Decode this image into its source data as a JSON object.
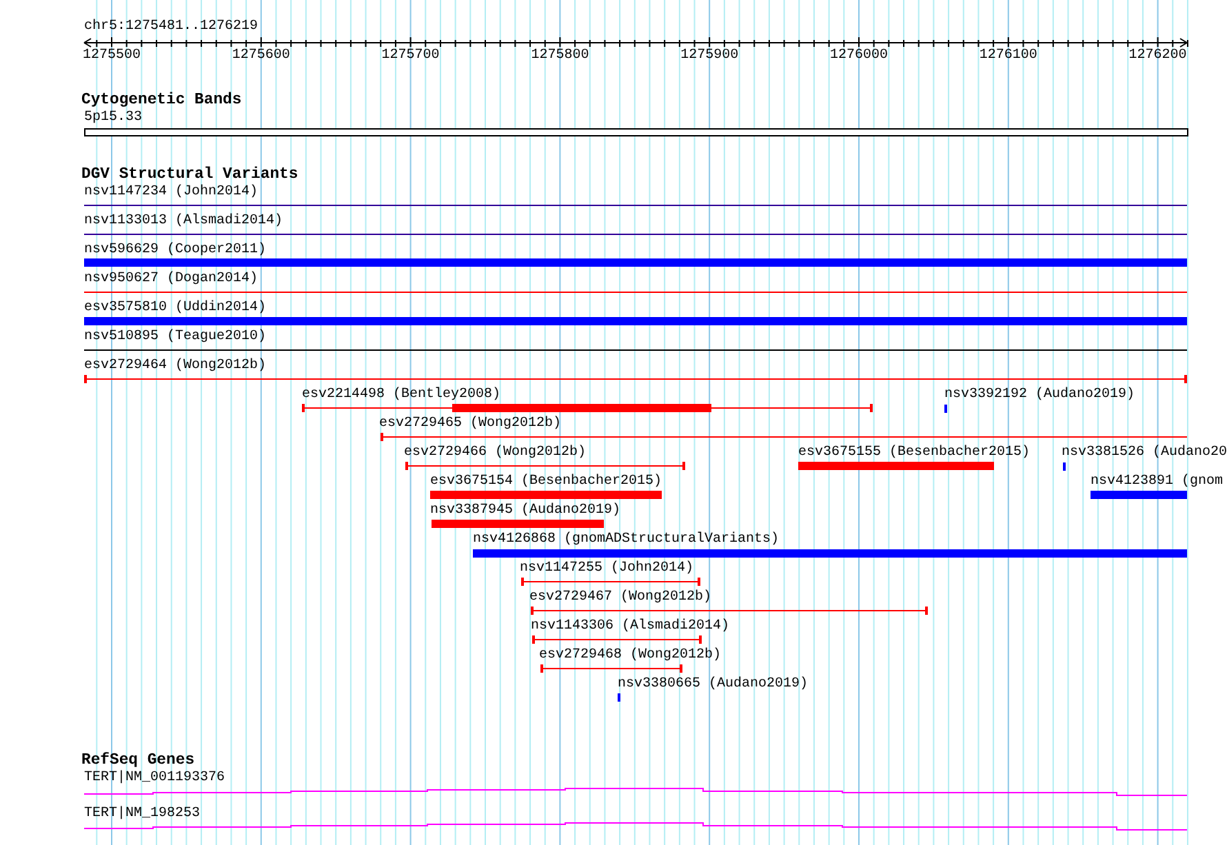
{
  "ruler": {
    "region": "chr5:1275481..1276219",
    "tick_labels": [
      "1275500",
      "1275600",
      "1275700",
      "1275800",
      "1275900",
      "1276000",
      "1276100",
      "1276200"
    ]
  },
  "cytogenetic_bands": {
    "title": "Cytogenetic Bands",
    "bands": [
      {
        "label": "5p15.33"
      }
    ]
  },
  "dgv_structural_variants": {
    "title": "DGV Structural Variants",
    "features": [
      {
        "label": "nsv1147234 (John2014)",
        "kind": "line",
        "color": "#330099"
      },
      {
        "label": "nsv1133013 (Alsmadi2014)",
        "kind": "line",
        "color": "#330099"
      },
      {
        "label": "nsv596629 (Cooper2011)",
        "kind": "bar",
        "color": "#0000ff"
      },
      {
        "label": "nsv950627 (Dogan2014)",
        "kind": "line",
        "color": "#ff0000"
      },
      {
        "label": "esv3575810 (Uddin2014)",
        "kind": "bar",
        "color": "#0000ff"
      },
      {
        "label": "nsv510895 (Teague2010)",
        "kind": "line",
        "color": "#000000"
      },
      {
        "label": "esv2729464 (Wong2012b)",
        "kind": "span",
        "color": "#ff0000"
      },
      {
        "label": "esv2214498 (Bentley2008)",
        "kind": "span-bar",
        "color": "#ff0000"
      },
      {
        "label": "nsv3392192 (Audano2019)",
        "kind": "tick",
        "color": "#0000ff"
      },
      {
        "label": "esv2729465 (Wong2012b)",
        "kind": "span",
        "color": "#ff0000"
      },
      {
        "label": "esv2729466 (Wong2012b)",
        "kind": "span",
        "color": "#ff0000"
      },
      {
        "label": "esv3675155 (Besenbacher2015)",
        "kind": "bar",
        "color": "#ff0000"
      },
      {
        "label": "nsv3381526 (Audano20",
        "kind": "tick",
        "color": "#0000ff"
      },
      {
        "label": "esv3675154 (Besenbacher2015)",
        "kind": "bar",
        "color": "#ff0000"
      },
      {
        "label": "nsv4123891 (gnom",
        "kind": "bar",
        "color": "#0000ff"
      },
      {
        "label": "nsv3387945 (Audano2019)",
        "kind": "bar",
        "color": "#ff0000"
      },
      {
        "label": "nsv4126868 (gnomADStructuralVariants)",
        "kind": "bar",
        "color": "#0000ff"
      },
      {
        "label": "nsv1147255 (John2014)",
        "kind": "span",
        "color": "#ff0000"
      },
      {
        "label": "esv2729467 (Wong2012b)",
        "kind": "span",
        "color": "#ff0000"
      },
      {
        "label": "nsv1143306 (Alsmadi2014)",
        "kind": "span",
        "color": "#ff0000"
      },
      {
        "label": "esv2729468 (Wong2012b)",
        "kind": "span",
        "color": "#ff0000"
      },
      {
        "label": "nsv3380665 (Audano2019)",
        "kind": "tick",
        "color": "#0000ff"
      }
    ]
  },
  "refseq_genes": {
    "title": "RefSeq Genes",
    "genes": [
      {
        "label": "TERT|NM_001193376"
      },
      {
        "label": "TERT|NM_198253"
      }
    ]
  }
}
